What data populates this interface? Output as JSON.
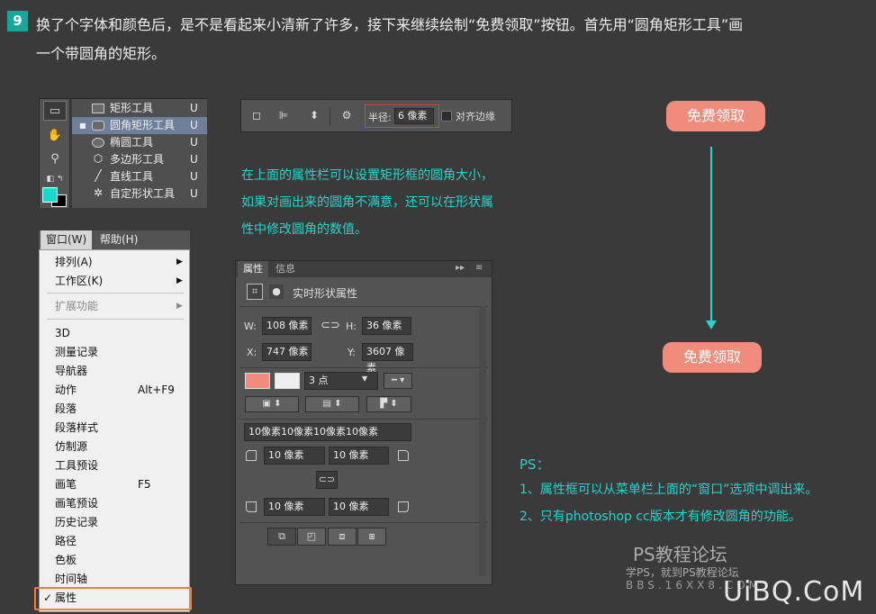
{
  "step": {
    "number": "9",
    "line1": "换了个字体和颜色后，是不是看起来小清新了许多，接下来继续绘制“免费领取”按钮。首先用“圆角矩形工具”画",
    "line2": "一个带圆角的矩形。"
  },
  "tool_menu": [
    {
      "icon": "rectangle-tool-icon",
      "label": "矩形工具",
      "key": "U",
      "selected": false
    },
    {
      "icon": "rounded-rectangle-tool-icon",
      "label": "圆角矩形工具",
      "key": "U",
      "selected": true
    },
    {
      "icon": "ellipse-tool-icon",
      "label": "椭圆工具",
      "key": "U",
      "selected": false
    },
    {
      "icon": "polygon-tool-icon",
      "label": "多边形工具",
      "key": "U",
      "selected": false
    },
    {
      "icon": "line-tool-icon",
      "label": "直线工具",
      "key": "U",
      "selected": false
    },
    {
      "icon": "custom-shape-tool-icon",
      "label": "自定形状工具",
      "key": "U",
      "selected": false
    }
  ],
  "options_bar": {
    "radius_label": "半径:",
    "radius_value": "6 像素",
    "align_edges_label": "对齐边缘"
  },
  "note": {
    "line1": "在上面的属性栏可以设置矩形框的圆角大小，",
    "line2": "如果对画出来的圆角不满意，还可以在形状属",
    "line3": "性中修改圆角的数值。"
  },
  "buttons": {
    "top": "免费领取",
    "bottom": "免费领取"
  },
  "menubar": {
    "window": "窗口(W)",
    "help": "帮助(H)"
  },
  "window_menu": {
    "group1": [
      {
        "label": "排列(A)",
        "sub": true
      },
      {
        "label": "工作区(K)",
        "sub": true
      }
    ],
    "extensions": "扩展功能",
    "items": [
      {
        "label": "3D",
        "shortcut": ""
      },
      {
        "label": "测量记录",
        "shortcut": ""
      },
      {
        "label": "导航器",
        "shortcut": ""
      },
      {
        "label": "动作",
        "shortcut": "Alt+F9"
      },
      {
        "label": "段落",
        "shortcut": ""
      },
      {
        "label": "段落样式",
        "shortcut": ""
      },
      {
        "label": "仿制源",
        "shortcut": ""
      },
      {
        "label": "工具预设",
        "shortcut": ""
      },
      {
        "label": "画笔",
        "shortcut": "F5"
      },
      {
        "label": "画笔预设",
        "shortcut": ""
      },
      {
        "label": "历史记录",
        "shortcut": ""
      },
      {
        "label": "路径",
        "shortcut": ""
      },
      {
        "label": "色板",
        "shortcut": ""
      },
      {
        "label": "时间轴",
        "shortcut": ""
      }
    ],
    "checked_item": "属性",
    "check_mark": "✓"
  },
  "properties": {
    "tab_active": "属性",
    "tab_other": "信息",
    "title": "实时形状属性",
    "w_label": "W:",
    "w": "108 像素",
    "h_label": "H:",
    "h": "36 像素",
    "x_label": "X:",
    "x": "747 像素",
    "y_label": "Y:",
    "y": "3607 像素",
    "stroke_width": "3 点",
    "corners_all": "10像素10像素10像素10像素",
    "c_tl": "10 像素",
    "c_tr": "10 像素",
    "c_bl": "10 像素",
    "c_br": "10 像素",
    "fill_color": "#f08c7c"
  },
  "ps_notes": {
    "title": "PS：",
    "line1": "1、属性框可以从菜单栏上面的“窗口”选项中调出来。",
    "line2": "2、只有photoshop cc版本才有修改圆角的功能。"
  },
  "watermark": {
    "name": "PS教程论坛",
    "slogan": "学PS，就到PS教程论坛",
    "url": "BBS.16XX8.COM",
    "logo": "UiBQ.CoM"
  },
  "colors": {
    "accent": "#23d6cc",
    "button": "#f08c7c",
    "highlight": "#f07f3f"
  }
}
